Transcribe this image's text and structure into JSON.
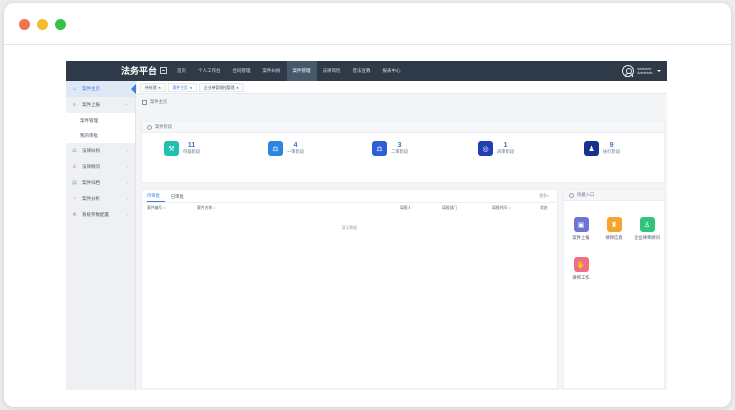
{
  "colors": {
    "topbar": "#2f3a48",
    "accent": "#3a7de0",
    "stat_teal": "#20c0b0",
    "stat_blue1": "#2a86e0",
    "stat_blue2": "#2d5ed6",
    "stat_navy": "#1f3fb5",
    "stat_darknavy": "#17308f",
    "q_purple": "#6b75d6",
    "q_orange": "#f4a52b",
    "q_green": "#33c37a",
    "q_pink": "#ee6f86"
  },
  "topbar": {
    "brand": "法务平台",
    "nav": [
      "首页",
      "个人工作台",
      "合同管理",
      "案件纠纷",
      "案件管理",
      "法律风险",
      "普法宣教",
      "报表中心"
    ],
    "active_nav": 4,
    "user_line1": "welcome",
    "user_line2": "Administr..."
  },
  "sidebar": {
    "items": [
      {
        "label": "案件主页",
        "icon": "home-icon",
        "glyph": "⌂"
      },
      {
        "label": "案件上报",
        "icon": "list-icon",
        "glyph": "≡"
      }
    ],
    "subitems": [
      "案件管理",
      "我的审批"
    ],
    "more_items": [
      {
        "label": "法律纠纷",
        "icon": "gavel-icon",
        "glyph": "⚖"
      },
      {
        "label": "法律顾问",
        "icon": "person-icon",
        "glyph": "♙"
      },
      {
        "label": "案件归档",
        "icon": "archive-icon",
        "glyph": "▤"
      },
      {
        "label": "案件分析",
        "icon": "chart-icon",
        "glyph": "◔"
      },
      {
        "label": "系统参数配置",
        "icon": "settings-icon",
        "glyph": "✲"
      }
    ]
  },
  "tabs": [
    {
      "label": "待处理",
      "close": "×"
    },
    {
      "label": "案件主页",
      "close": "×"
    },
    {
      "label": "企业单管理档管理",
      "close": "×"
    }
  ],
  "breadcrumb": "案件主页",
  "stats_panel": {
    "title": "案件阶段",
    "items": [
      {
        "num": "11",
        "label": "待裁阶段",
        "icon": "gavel-icon",
        "glyph": "⚒"
      },
      {
        "num": "4",
        "label": "一审阶段",
        "icon": "hammer-icon",
        "glyph": "⚖"
      },
      {
        "num": "3",
        "label": "二审阶段",
        "icon": "hammer2-icon",
        "glyph": "⚖"
      },
      {
        "num": "1",
        "label": "再审阶段",
        "icon": "seal-icon",
        "glyph": "◎"
      },
      {
        "num": "9",
        "label": "执行阶段",
        "icon": "pawn-icon",
        "glyph": "♟"
      }
    ]
  },
  "cases_panel": {
    "tabs": [
      "待审批",
      "已审批"
    ],
    "more": "更多>",
    "columns": [
      "案件编号 ↕",
      "案件名称 ↕",
      "填报人",
      "填报部门",
      "填报时间 ↕",
      "状态"
    ],
    "empty": "暂无数据"
  },
  "quick_panel": {
    "title": "快捷入口",
    "items": [
      {
        "label": "案件上报",
        "icon": "report-icon",
        "glyph": "▣"
      },
      {
        "label": "律师信息",
        "icon": "lawyer-icon",
        "glyph": "♜"
      },
      {
        "label": "企业律师顾问",
        "icon": "advisor-icon",
        "glyph": "♙"
      },
      {
        "label": "律师工作",
        "icon": "handshake-icon",
        "glyph": "✋"
      }
    ]
  }
}
